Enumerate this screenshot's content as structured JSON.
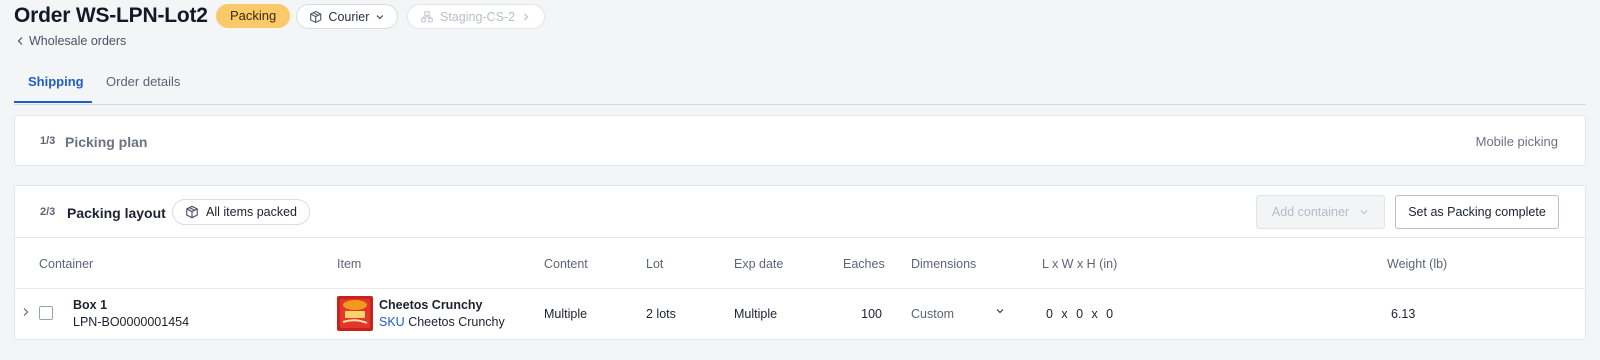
{
  "header": {
    "title": "Order WS-LPN-Lot2",
    "status_badge": "Packing",
    "carrier_pill": {
      "label": "Courier",
      "icon": "box-icon",
      "chevron": "chevron-down-icon"
    },
    "location_pill": {
      "label": "Staging-CS-2",
      "icon": "warehouse-icon",
      "chevron": "chevron-right-icon"
    },
    "back_link": "Wholesale orders"
  },
  "tabs": [
    {
      "label": "Shipping",
      "active": true
    },
    {
      "label": "Order details",
      "active": false
    }
  ],
  "picking_plan": {
    "step": "1/3",
    "title": "Picking plan",
    "action": "Mobile picking"
  },
  "packing_layout": {
    "step": "2/3",
    "title": "Packing layout",
    "status_pill": "All items packed",
    "add_container_label": "Add container",
    "complete_button_label": "Set as Packing complete",
    "columns": {
      "container": "Container",
      "item": "Item",
      "content": "Content",
      "lot": "Lot",
      "exp_date": "Exp date",
      "eaches": "Eaches",
      "dimensions": "Dimensions",
      "lwh": "L x W x H (in)",
      "weight": "Weight (lb)"
    },
    "rows": [
      {
        "container_name": "Box 1",
        "container_lpn": "LPN-BO0000001454",
        "item_name": "Cheetos Crunchy",
        "sku_label": "SKU",
        "sku_value": "Cheetos Crunchy",
        "content": "Multiple",
        "lot": "2 lots",
        "exp_date": "Multiple",
        "eaches": "100",
        "dimensions": "Custom",
        "lwh": "0  x  0  x  0",
        "weight": "6.13"
      }
    ]
  },
  "colors": {
    "accent": "#1b5fc9",
    "packing_badge": "#f9c96a",
    "background": "#f4f5f7"
  }
}
